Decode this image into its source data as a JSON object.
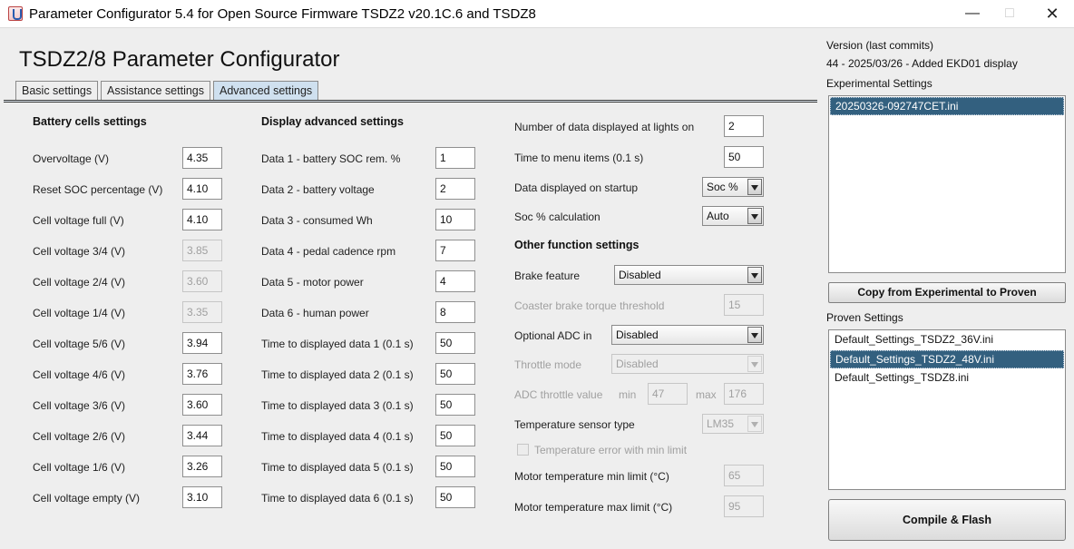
{
  "window": {
    "title": "Parameter Configurator 5.4 for Open Source Firmware TSDZ2 v20.1C.6 and TSDZ8"
  },
  "main": {
    "title": "TSDZ2/8 Parameter Configurator"
  },
  "tabs": [
    {
      "label": "Basic settings",
      "active": false
    },
    {
      "label": "Assistance settings",
      "active": false
    },
    {
      "label": "Advanced settings",
      "active": true
    }
  ],
  "battery": {
    "heading": "Battery cells settings",
    "rows": [
      {
        "label": "Overvoltage (V)",
        "value": "4.35",
        "enabled": true
      },
      {
        "label": "Reset SOC percentage (V)",
        "value": "4.10",
        "enabled": true
      },
      {
        "label": "Cell voltage full (V)",
        "value": "4.10",
        "enabled": true
      },
      {
        "label": "Cell voltage 3/4 (V)",
        "value": "3.85",
        "enabled": false
      },
      {
        "label": "Cell voltage 2/4 (V)",
        "value": "3.60",
        "enabled": false
      },
      {
        "label": "Cell voltage 1/4 (V)",
        "value": "3.35",
        "enabled": false
      },
      {
        "label": "Cell voltage 5/6 (V)",
        "value": "3.94",
        "enabled": true
      },
      {
        "label": "Cell voltage 4/6 (V)",
        "value": "3.76",
        "enabled": true
      },
      {
        "label": "Cell voltage 3/6 (V)",
        "value": "3.60",
        "enabled": true
      },
      {
        "label": "Cell voltage 2/6 (V)",
        "value": "3.44",
        "enabled": true
      },
      {
        "label": "Cell voltage 1/6 (V)",
        "value": "3.26",
        "enabled": true
      },
      {
        "label": "Cell voltage empty (V)",
        "value": "3.10",
        "enabled": true
      }
    ]
  },
  "display": {
    "heading": "Display advanced settings",
    "rows": [
      {
        "label": "Data 1 - battery SOC rem. %",
        "value": "1"
      },
      {
        "label": "Data 2 - battery voltage",
        "value": "2"
      },
      {
        "label": "Data 3 - consumed Wh",
        "value": "10"
      },
      {
        "label": "Data 4 - pedal cadence rpm",
        "value": "7"
      },
      {
        "label": "Data 5 - motor power",
        "value": "4"
      },
      {
        "label": "Data 6 - human power",
        "value": "8"
      },
      {
        "label": "Time to displayed data 1 (0.1 s)",
        "value": "50"
      },
      {
        "label": "Time to displayed data 2 (0.1 s)",
        "value": "50"
      },
      {
        "label": "Time to displayed data 3 (0.1 s)",
        "value": "50"
      },
      {
        "label": "Time to displayed data 4 (0.1 s)",
        "value": "50"
      },
      {
        "label": "Time to displayed data 5 (0.1 s)",
        "value": "50"
      },
      {
        "label": "Time to displayed data 6 (0.1 s)",
        "value": "50"
      }
    ]
  },
  "misc": {
    "lights_data_label": "Number of data displayed at lights on",
    "lights_data_value": "2",
    "menu_time_label": "Time to menu items (0.1 s)",
    "menu_time_value": "50",
    "startup_label": "Data displayed on startup",
    "startup_value": "Soc %",
    "soc_calc_label": "Soc % calculation",
    "soc_calc_value": "Auto"
  },
  "other": {
    "heading": "Other function settings",
    "brake_label": "Brake feature",
    "brake_value": "Disabled",
    "coaster_label": "Coaster brake torque threshold",
    "coaster_value": "15",
    "adc_label": "Optional ADC in",
    "adc_value": "Disabled",
    "throttle_mode_label": "Throttle mode",
    "throttle_mode_value": "Disabled",
    "adc_throttle_label": "ADC throttle value",
    "min_label": "min",
    "min_value": "47",
    "max_label": "max",
    "max_value": "176",
    "temp_sensor_label": "Temperature sensor type",
    "temp_sensor_value": "LM35",
    "temp_error_label": "Temperature error with min limit",
    "temp_error_checked": false,
    "motor_temp_min_label": "Motor temperature min limit (°C)",
    "motor_temp_min_value": "65",
    "motor_temp_max_label": "Motor temperature max limit (°C)",
    "motor_temp_max_value": "95"
  },
  "right": {
    "version_label": "Version (last commits)",
    "version_value": "44 - 2025/03/26 - Added EKD01 display",
    "experimental_label": "Experimental Settings",
    "experimental_items": [
      "20250326-092747CET.ini"
    ],
    "experimental_selected": 0,
    "copy_button": "Copy from Experimental to Proven",
    "proven_label": "Proven Settings",
    "proven_items": [
      "Default_Settings_TSDZ2_36V.ini",
      "Default_Settings_TSDZ2_48V.ini",
      "Default_Settings_TSDZ8.ini"
    ],
    "proven_selected": 1,
    "compile_button": "Compile & Flash"
  },
  "icons": {
    "app": "java-app-icon",
    "minimize": "minimize-icon",
    "maximize": "maximize-icon",
    "close": "close-icon",
    "dropdown": "chevron-down-icon"
  }
}
